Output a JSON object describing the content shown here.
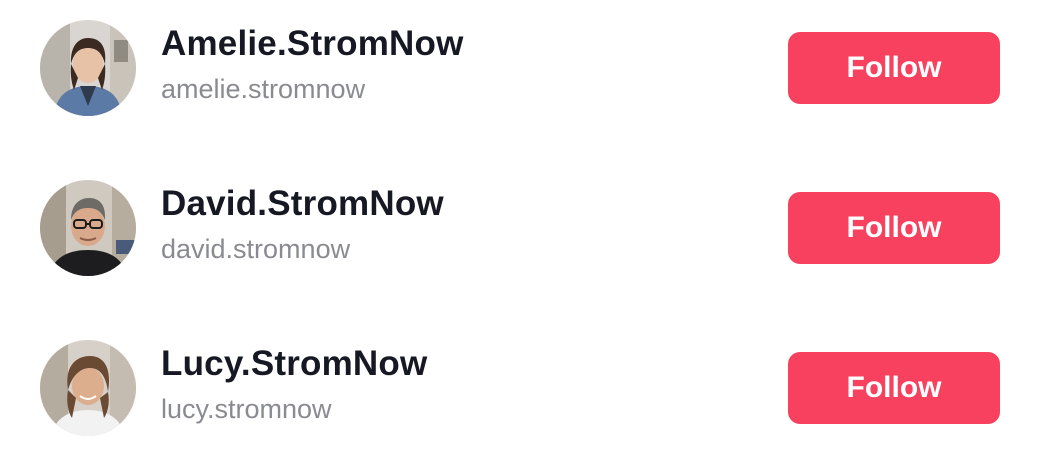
{
  "colors": {
    "accent": "#f7415e",
    "name_text": "#161823",
    "username_text": "#8a8b91"
  },
  "users": [
    {
      "display_name": "Amelie.StromNow",
      "username": "amelie.stromnow",
      "follow_label": "Follow",
      "avatar": "avatar-photo"
    },
    {
      "display_name": "David.StromNow",
      "username": "david.stromnow",
      "follow_label": "Follow",
      "avatar": "avatar-photo"
    },
    {
      "display_name": "Lucy.StromNow",
      "username": "lucy.stromnow",
      "follow_label": "Follow",
      "avatar": "avatar-photo"
    }
  ]
}
